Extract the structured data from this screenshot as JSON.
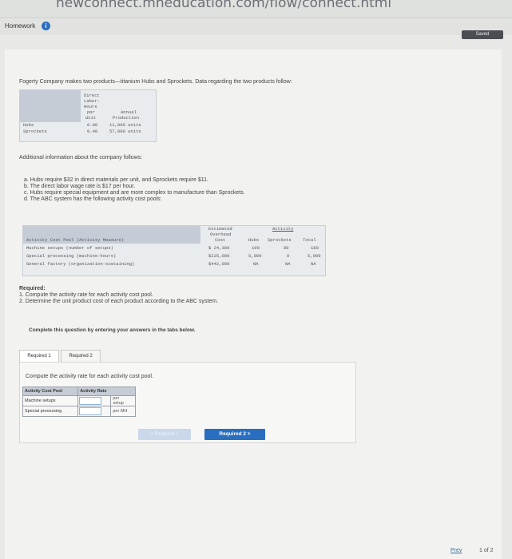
{
  "browser": {
    "url": "newconnect.mheducation.com/flow/connect.html"
  },
  "header": {
    "homework_label": "Homework",
    "info_icon": "i",
    "saved_label": "Saved"
  },
  "intro": "Fogerty Company makes two products—titanium Hubs and Sprockets. Data regarding the two products follow:",
  "product_table": {
    "headers": {
      "dlh_l1": "Direct",
      "dlh_l2": "Labor-",
      "dlh_l3": "Hours",
      "dlh_l4": "per",
      "dlh_l5": "Unit",
      "ap_l1": "Annual",
      "ap_l2": "Production"
    },
    "rows": [
      {
        "name": "Hubs",
        "dlh": "0.80",
        "production": "11,000 units"
      },
      {
        "name": "Sprockets",
        "dlh": "0.40",
        "production": "57,000 units"
      }
    ]
  },
  "additional": "Additional information about the company follows:",
  "items": [
    "a. Hubs require $32 in direct materials per unit, and Sprockets require $11.",
    "b. The direct labor wage rate is $17 per hour.",
    "c. Hubs require special equipment and are more complex to manufacture than Sprockets.",
    "d. The ABC system has the following activity cost pools:"
  ],
  "activity_table": {
    "est_l1": "Estimated",
    "est_l2": "Overhead",
    "est_l3": "Cost",
    "activity_header": "Activity",
    "col_pool": "Activity Cost Pool (Activity Measure)",
    "col_hubs": "Hubs",
    "col_sprockets": "Sprockets",
    "col_total": "Total",
    "rows": [
      {
        "pool": "Machine setups (number of setups)",
        "cost": "$ 24,300",
        "hubs": "100",
        "sprockets": "80",
        "total": "180"
      },
      {
        "pool": "Special processing (machine-hours)",
        "cost": "$225,000",
        "hubs": "5,000",
        "sprockets": "0",
        "total": "5,000"
      },
      {
        "pool": "General factory (organization-sustaining)",
        "cost": "$442,000",
        "hubs": "NA",
        "sprockets": "NA",
        "total": "NA"
      }
    ]
  },
  "required": {
    "title": "Required:",
    "r1": "1. Compute the activity rate for each activity cost pool.",
    "r2": "2. Determine the unit product cost of each product according to the ABC system."
  },
  "instruction": "Complete this question by entering your answers in the tabs below.",
  "tabs": [
    {
      "label": "Required 1"
    },
    {
      "label": "Required 2"
    }
  ],
  "panel": {
    "question": "Compute the activity rate for each activity cost pool.",
    "col_pool": "Activity Cost Pool",
    "col_rate": "Activity Rate",
    "rows": [
      {
        "pool": "Machine setups",
        "value": "",
        "unit_l1": "per",
        "unit_l2": "setup"
      },
      {
        "pool": "Special processing",
        "value": "",
        "unit_l1": "per MH",
        "unit_l2": ""
      }
    ]
  },
  "nav": {
    "prev_label": "< Required 1",
    "next_label": "Required 2 >"
  },
  "pager": {
    "prev_label": "Prev",
    "count": "1 of 2"
  }
}
